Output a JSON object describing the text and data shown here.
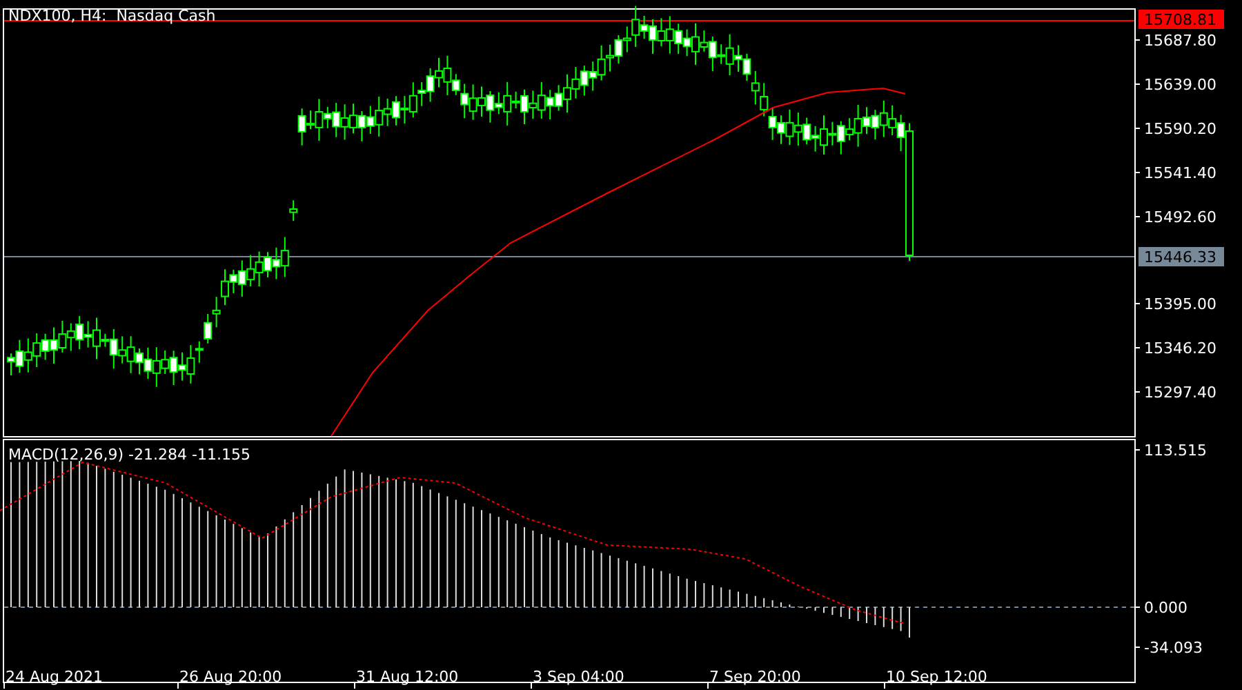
{
  "chart": {
    "title": "NDX100, H4:  Nasdaq Cash",
    "price_axis": [
      "15687.80",
      "15639.00",
      "15590.20",
      "15541.40",
      "15492.60",
      "15395.00",
      "15346.20",
      "15297.40"
    ],
    "price_tags": [
      {
        "kind": "alert",
        "label": "15708.81",
        "color": "#ff0000"
      },
      {
        "kind": "bid",
        "label": "15446.33",
        "color": "#778899"
      }
    ]
  },
  "indicator": {
    "label": "MACD(12,26,9) -21.284 -11.155",
    "axis": [
      "113.515",
      "0.000",
      "-34.093"
    ]
  },
  "time_axis": [
    "24 Aug 2021",
    "26 Aug 20:00",
    "31 Aug 12:00",
    "3 Sep 04:00",
    "7 Sep 20:00",
    "10 Sep 12:00"
  ]
}
